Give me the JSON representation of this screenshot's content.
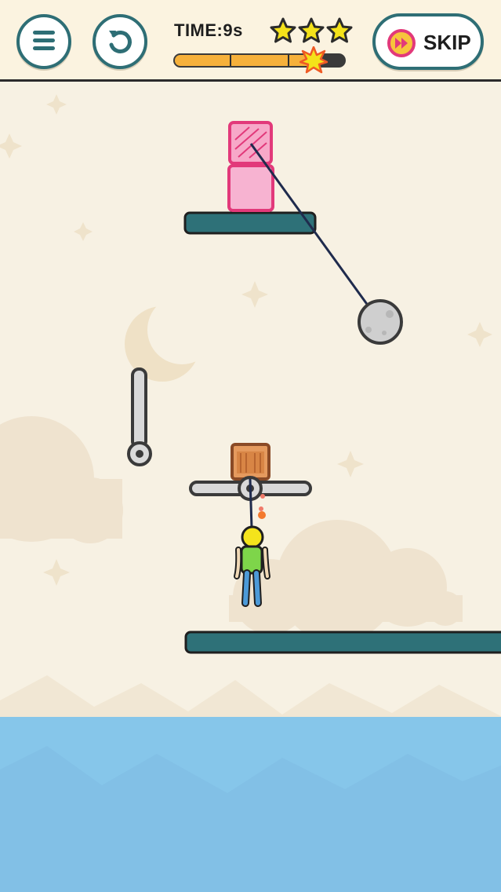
{
  "hud": {
    "menu_icon": "hamburger-menu-icon",
    "restart_icon": "restart-arrow-icon",
    "time_label": "TIME:9s",
    "stars_earned": 3,
    "stars_total": 3,
    "time_progress": 0.82,
    "skip_label": "SKIP",
    "skip_icon": "fast-forward-icon"
  },
  "colors": {
    "accent": "#2e6e75",
    "sky_background": "#f7f1e3",
    "water": "#86c6ea",
    "star": "#f4e21a",
    "progress_fill": "#f6b13b",
    "pink_block": "#f7a8c8",
    "rope": "#1f2b4d"
  },
  "scene": {
    "objects": [
      "pink-block-striped",
      "pink-block",
      "upper-teal-platform",
      "rope",
      "gray-wrecking-ball",
      "vertical-pin",
      "horizontal-pin",
      "wooden-crate",
      "stickman",
      "lower-teal-platform",
      "water"
    ]
  }
}
